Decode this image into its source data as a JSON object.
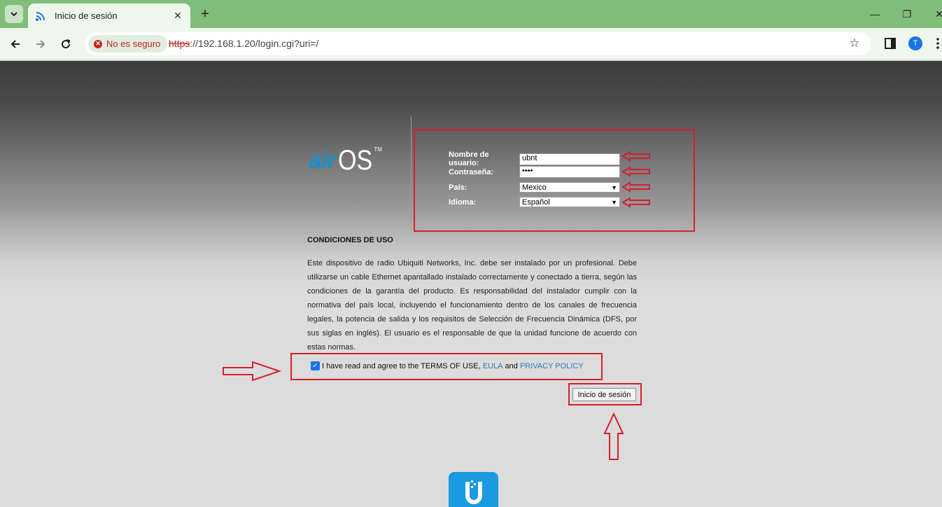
{
  "browser": {
    "tab_title": "Inicio de sesión",
    "security_label": "No es seguro",
    "url_scheme": "https",
    "url_rest": "://192.168.1.20/login.cgi?uri=/",
    "avatar_initial": "T"
  },
  "logo": {
    "air": "air",
    "os": "OS",
    "tm": "TM"
  },
  "form": {
    "username_label": "Nombre de usuario:",
    "username_value": "ubnt",
    "password_label": "Contraseña:",
    "password_value": "••••",
    "country_label": "País:",
    "country_value": "Mexico",
    "language_label": "Idioma:",
    "language_value": "Español"
  },
  "terms": {
    "title": "CONDICIONES DE USO",
    "body": "Este dispositivo de radio Ubiquiti Networks, Inc. debe ser instalado por un profesional. Debe utilizarse un cable Ethernet apantallado instalado correctamente y conectado a tierra, según las condiciones de la garantía del producto. Es responsabilidad del instalador cumplir con la normativa del país local, incluyendo el funcionamiento dentro de los canales de frecuencia legales, la potencia de salida y los requisitos de Selección de Frecuencia Dinámica (DFS, por sus siglas en inglés). El usuario es el responsable de que la unidad funcione de acuerdo con estas normas.",
    "agree_text": "I have read and agree to the TERMS OF USE,",
    "eula": "EULA",
    "and": "and",
    "privacy": "PRIVACY POLICY",
    "agree_checked": true
  },
  "login_button": "Inicio de sesión",
  "colors": {
    "tabbar": "#7fbd7a",
    "annotation": "#d4202a",
    "brand_blue": "#1a90d0"
  }
}
